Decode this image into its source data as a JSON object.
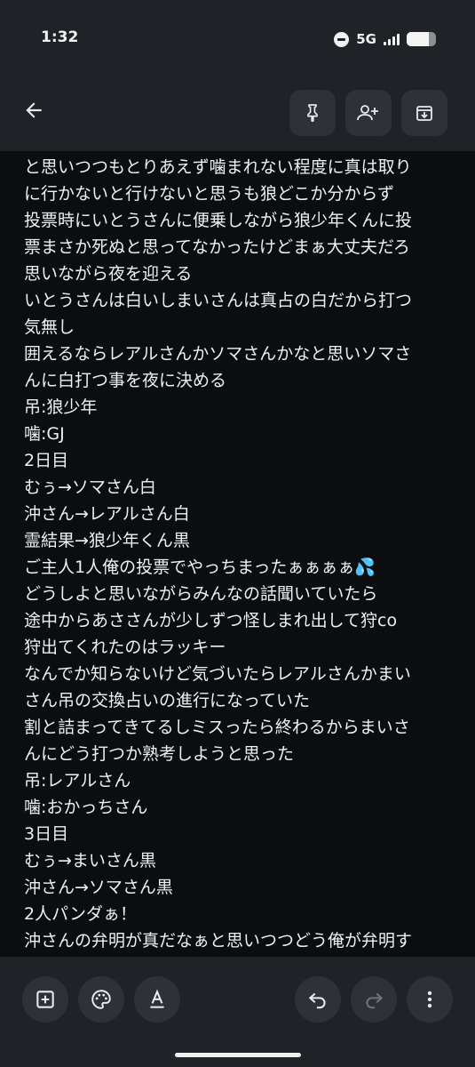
{
  "status_bar": {
    "time": "1:32",
    "network": "5G",
    "battery_level": 0.75,
    "icons": [
      "do-not-disturb-icon",
      "signal-icon",
      "battery-icon"
    ]
  },
  "toolbar": {
    "icons": [
      "back-arrow-icon",
      "pin-icon",
      "add-collaborator-icon",
      "archive-icon"
    ]
  },
  "note": {
    "lines": [
      "と思いつつもとりあえず噛まれない程度に真は取り",
      "に行かないと行けないと思うも狼どこか分からず",
      "投票時にいとうさんに便乗しながら狼少年くんに投",
      "票まさか死ぬと思ってなかったけどまぁ大丈夫だろ",
      "思いながら夜を迎える",
      "いとうさんは白いしまいさんは真占の白だから打つ",
      "気無し",
      "囲えるならレアルさんかソマさんかなと思いソマさ",
      "んに白打つ事を夜に決める",
      "吊:狼少年",
      "噛:GJ",
      "2日目",
      "むぅ→ソマさん白",
      "沖さん→レアルさん白",
      "霊結果→狼少年くん黒",
      "ご主人1人俺の投票でやっちまったぁぁぁぁ💦",
      "どうしよと思いながらみんなの話聞いていたら",
      "途中からあささんが少しずつ怪しまれ出して狩co",
      "狩出てくれたのはラッキー",
      "なんでか知らないけど気づいたらレアルさんかまい",
      "さん吊の交換占いの進行になっていた",
      "割と詰まってきてるしミスったら終わるからまいさ",
      "んにどう打つか熟考しようと思った",
      "吊:レアルさん",
      "噛:おかっちさん",
      "3日目",
      "むぅ→まいさん黒",
      "沖さん→ソマさん黒",
      "2人パンダぁ！",
      "沖さんの弁明が真だなぁと思いつつどう俺が弁明す"
    ]
  },
  "bottom_toolbar": {
    "icons": [
      "add-box-icon",
      "palette-icon",
      "text-format-icon",
      "undo-icon",
      "redo-icon",
      "more-vert-icon"
    ]
  },
  "colors": {
    "chrome": "#1f2226",
    "note_background": "#0b0d10",
    "button_background": "#2e3238",
    "text": "#eef0f2"
  }
}
